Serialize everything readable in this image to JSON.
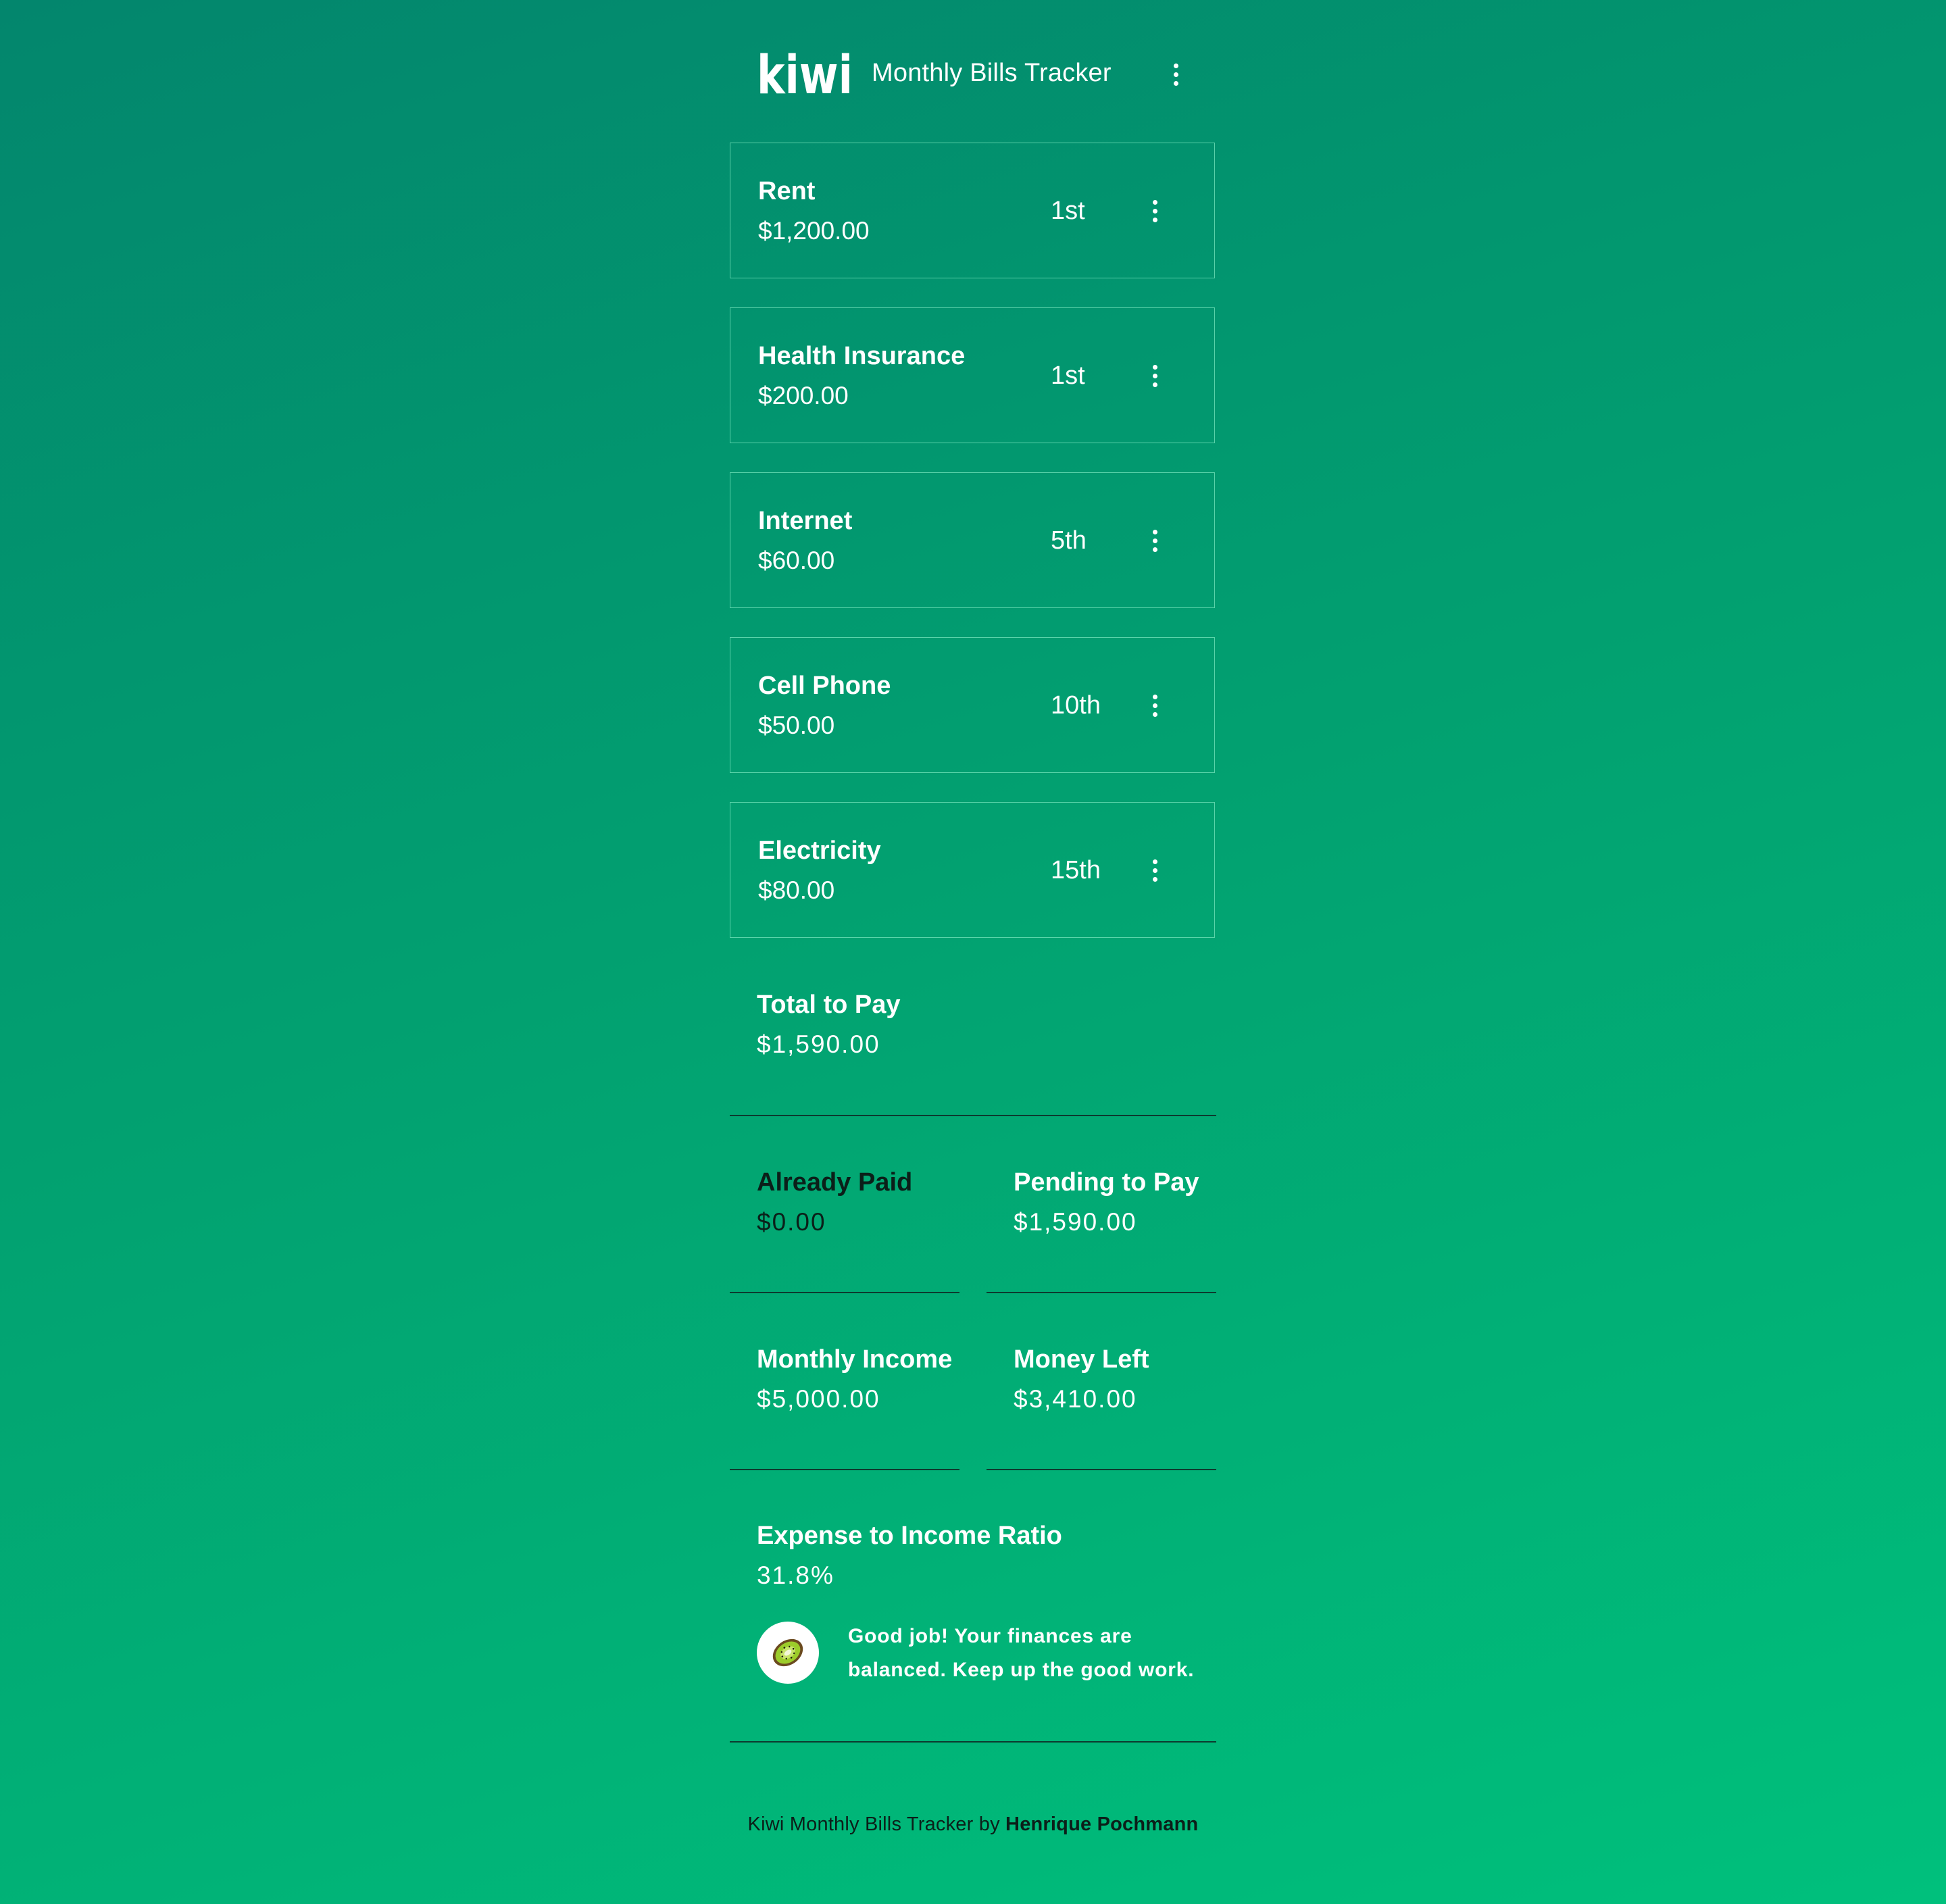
{
  "header": {
    "logo_text": "kiwi",
    "title": "Monthly Bills Tracker",
    "menu_icon": "more-vertical-icon"
  },
  "bills": [
    {
      "name": "Rent",
      "amount": "$1,200.00",
      "due": "1st"
    },
    {
      "name": "Health Insurance",
      "amount": "$200.00",
      "due": "1st"
    },
    {
      "name": "Internet",
      "amount": "$60.00",
      "due": "5th"
    },
    {
      "name": "Cell Phone",
      "amount": "$50.00",
      "due": "10th"
    },
    {
      "name": "Electricity",
      "amount": "$80.00",
      "due": "15th"
    }
  ],
  "summary": {
    "total": {
      "label": "Total to Pay",
      "value": "$1,590.00"
    },
    "already_paid": {
      "label": "Already Paid",
      "value": "$0.00"
    },
    "pending": {
      "label": "Pending to Pay",
      "value": "$1,590.00"
    },
    "income": {
      "label": "Monthly Income",
      "value": "$5,000.00"
    },
    "money_left": {
      "label": "Money Left",
      "value": "$3,410.00"
    },
    "ratio": {
      "label": "Expense to Income Ratio",
      "value": "31.8%"
    }
  },
  "message": {
    "icon": "kiwi-fruit-icon",
    "text": "Good job! Your finances are balanced. Keep up the good work."
  },
  "footer": {
    "prefix": "Kiwi Monthly Bills Tracker by",
    "author": "Henrique Pochmann"
  },
  "colors": {
    "gradient_start": "#03866d",
    "gradient_end": "#00c07c",
    "divider": "#0d3b2f",
    "card_border": "#78e6be",
    "dark_text": "#0b1f19"
  }
}
